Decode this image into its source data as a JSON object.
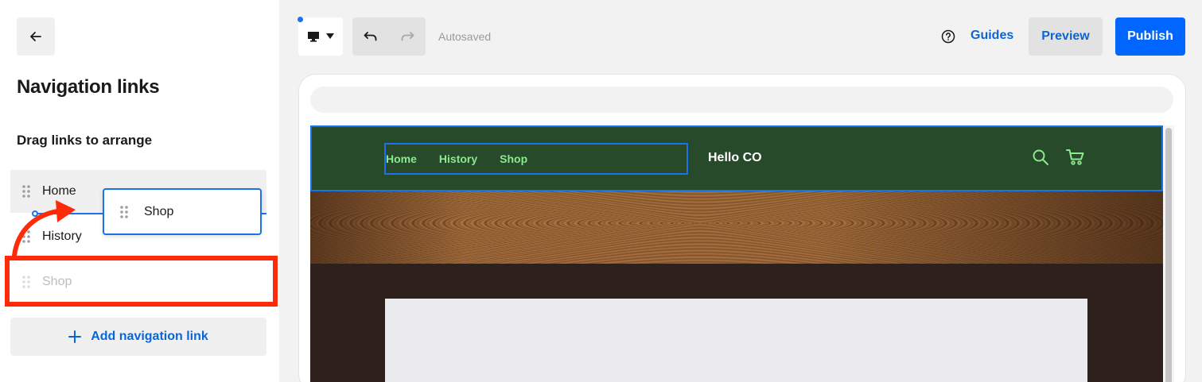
{
  "sidebar": {
    "title": "Navigation links",
    "subtitle": "Drag links to arrange",
    "links": [
      {
        "label": "Home"
      },
      {
        "label": "History"
      },
      {
        "label": "Shop"
      }
    ],
    "dragging_label": "Shop",
    "add_link_label": "Add navigation link"
  },
  "toolbar": {
    "status": "Autosaved",
    "guides_label": "Guides",
    "preview_label": "Preview",
    "publish_label": "Publish"
  },
  "site": {
    "nav_links": [
      "Home",
      "History",
      "Shop"
    ],
    "brand": "Hello CO"
  },
  "colors": {
    "accent": "#0066ff",
    "link_blue": "#0a66d8",
    "highlight_red": "#ff2a0a",
    "site_header_bg": "#274a2b",
    "site_nav_text": "#8de88f"
  },
  "icons": {
    "back": "arrow-left-icon",
    "device": "desktop-icon",
    "undo": "undo-icon",
    "redo": "redo-icon",
    "help": "question-circle-icon",
    "add": "plus-icon",
    "grip": "drag-handle-icon",
    "search": "search-icon",
    "cart": "cart-icon"
  }
}
